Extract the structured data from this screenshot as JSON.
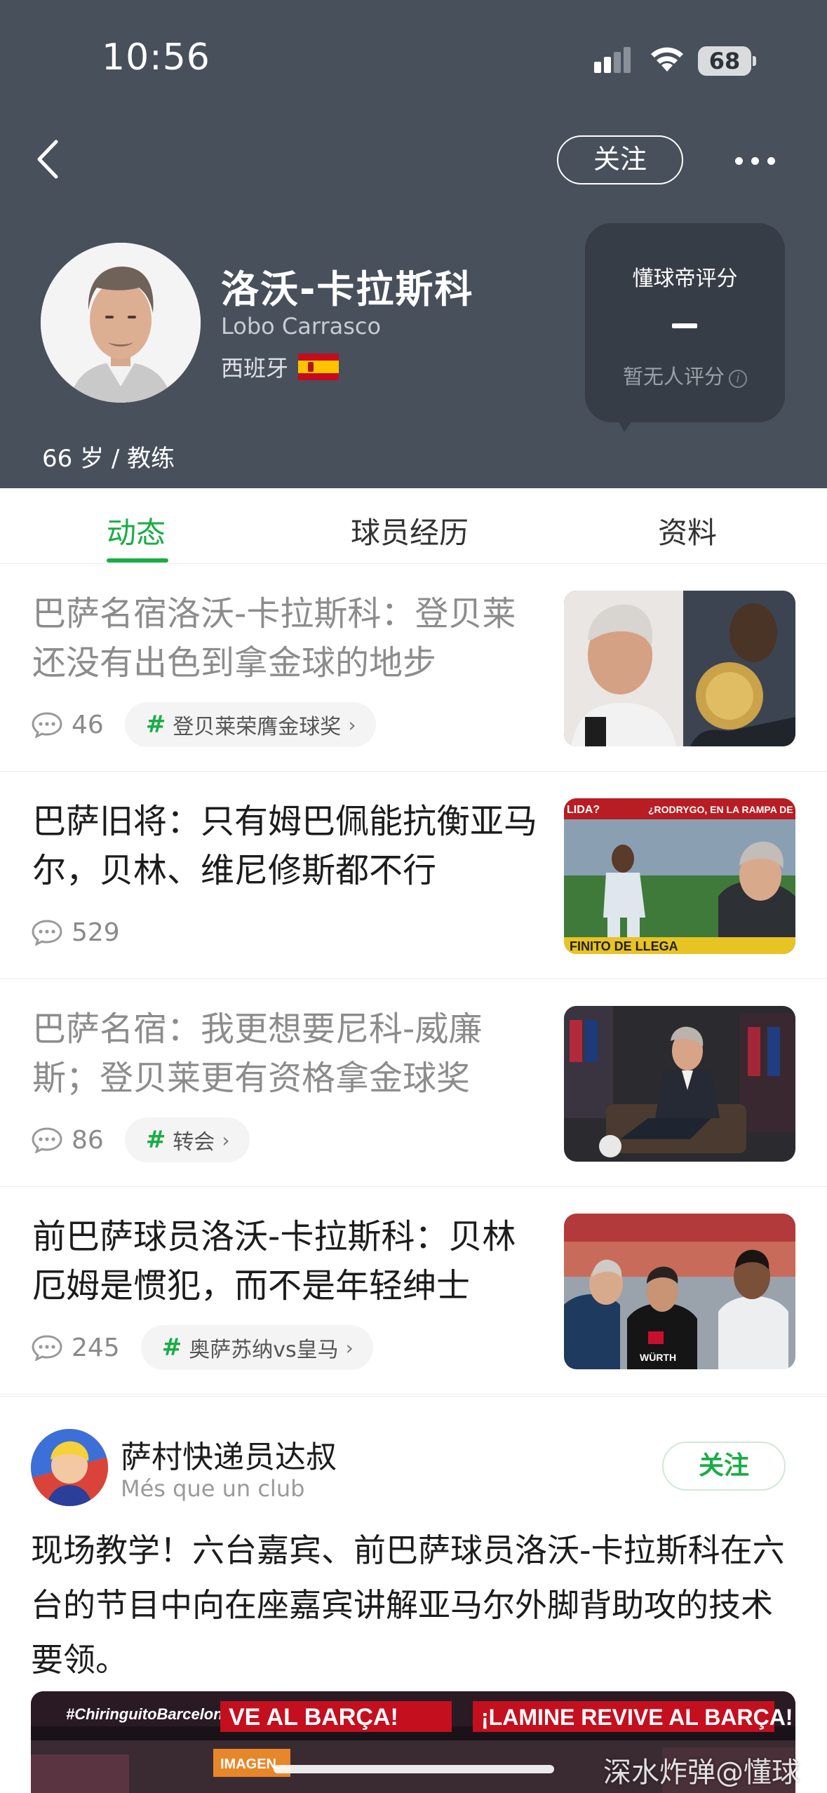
{
  "status_bar": {
    "time": "10:56",
    "battery": "68"
  },
  "header": {
    "follow_label": "关注",
    "name": "洛沃-卡拉斯科",
    "name_en": "Lobo Carrasco",
    "country": "西班牙",
    "age_role": "66 岁 / 教练",
    "rating": {
      "title": "懂球帝评分",
      "value": "-",
      "note": "暂无人评分"
    }
  },
  "tabs": [
    {
      "label": "动态",
      "active": true
    },
    {
      "label": "球员经历",
      "active": false
    },
    {
      "label": "资料",
      "active": false
    }
  ],
  "news": [
    {
      "title": "巴萨名宿洛沃-卡拉斯科：登贝莱还没有出色到拿金球的地步",
      "read": true,
      "comments": "46",
      "tag": "登贝莱荣膺金球奖"
    },
    {
      "title": "巴萨旧将：只有姆巴佩能抗衡亚马尔，贝林、维尼修斯都不行",
      "read": false,
      "comments": "529",
      "tag": ""
    },
    {
      "title": "巴萨名宿：我更想要尼科-威廉斯；登贝莱更有资格拿金球奖",
      "read": true,
      "comments": "86",
      "tag": "转会"
    },
    {
      "title": "前巴萨球员洛沃-卡拉斯科：贝林厄姆是惯犯，而不是年轻绅士",
      "read": false,
      "comments": "245",
      "tag": "奥萨苏纳vs皇马"
    }
  ],
  "thumb_text": {
    "item2_banner_left": "LIDA?",
    "item2_banner_right": "¿RODRYGO, EN LA RAMPA DE SA",
    "item2_bottom": "FINITO DE LLEGA",
    "item4_sponsor": "WÜRTH"
  },
  "post": {
    "author": "萨村快递员达叔",
    "subtitle": "Més que un club",
    "follow_label": "关注",
    "text": "现场教学！六台嘉宾、前巴萨球员洛沃-卡拉斯科在六台的节目中向在座嘉宾讲解亚马尔外脚背助攻的技术要领。",
    "video": {
      "hashtag": "#ChiringuitoBarcelona",
      "banner_left": "VE AL BARÇA!",
      "banner_right": "¡LAMINE REVIVE AL BARÇA!",
      "badge": "IMAGEN"
    }
  },
  "watermark": "深水炸弹@懂球帝"
}
